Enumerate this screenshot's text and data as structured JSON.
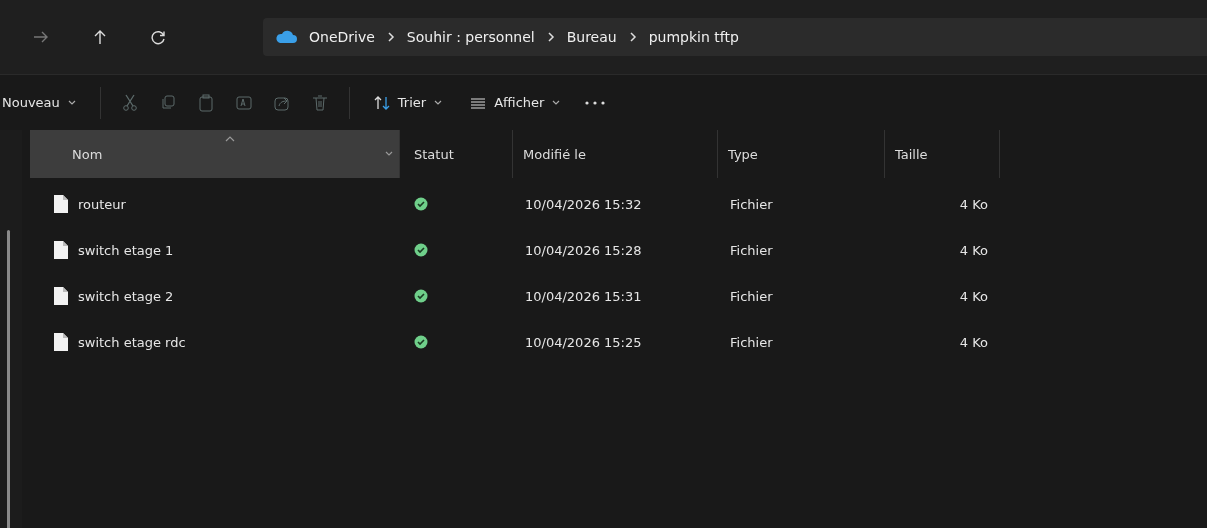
{
  "address_bar": {
    "breadcrumbs": [
      "OneDrive",
      "Souhir : personnel",
      "Bureau",
      "pumpkin  tftp"
    ]
  },
  "toolbar": {
    "new_label": "Nouveau",
    "sort_label": "Trier",
    "view_label": "Afficher"
  },
  "table": {
    "columns": [
      {
        "label": "Nom",
        "sorted": true
      },
      {
        "label": "Statut",
        "sorted": false
      },
      {
        "label": "Modifié le",
        "sorted": false
      },
      {
        "label": "Type",
        "sorted": false
      },
      {
        "label": "Taille",
        "sorted": false
      }
    ],
    "rows": [
      {
        "name": "routeur",
        "modified": "10/04/2026 15:32",
        "type": "Fichier",
        "size": "4 Ko"
      },
      {
        "name": "switch etage 1",
        "modified": "10/04/2026 15:28",
        "type": "Fichier",
        "size": "4 Ko"
      },
      {
        "name": "switch etage 2",
        "modified": "10/04/2026 15:31",
        "type": "Fichier",
        "size": "4 Ko"
      },
      {
        "name": "switch etage rdc",
        "modified": "10/04/2026 15:25",
        "type": "Fichier",
        "size": "4 Ko"
      }
    ]
  }
}
